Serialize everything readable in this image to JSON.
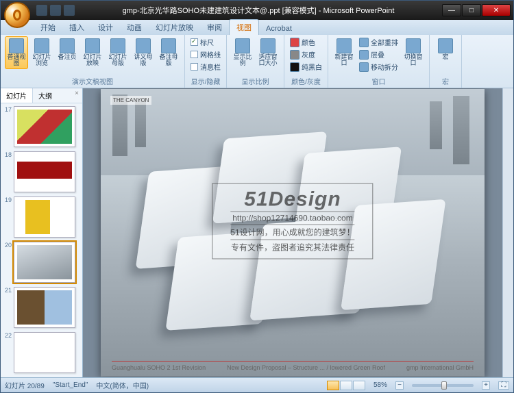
{
  "window": {
    "title": "gmp-北京光华路SOHO未建建筑设计文本@.ppt [兼容模式] - Microsoft PowerPoint",
    "min": "—",
    "max": "□",
    "close": "✕"
  },
  "tabs": [
    "开始",
    "插入",
    "设计",
    "动画",
    "幻灯片放映",
    "审阅",
    "视图",
    "Acrobat"
  ],
  "active_tab": 6,
  "ribbon": {
    "g1": {
      "label": "演示文稿视图",
      "items": [
        "普通视图",
        "幻灯片浏览",
        "备注页",
        "幻灯片放映",
        "幻灯片母版",
        "讲义母版",
        "备注母版"
      ]
    },
    "g2": {
      "label": "显示/隐藏",
      "items": [
        "标尺",
        "网格线",
        "消息栏"
      ]
    },
    "g3": {
      "label": "显示比例",
      "items": [
        "显示比例",
        "适应窗口大小"
      ]
    },
    "g4": {
      "label": "颜色/灰度",
      "items": [
        "颜色",
        "灰度",
        "纯黑白"
      ]
    },
    "g5": {
      "label": "窗口",
      "items": [
        "新建窗口",
        "全部重排",
        "层叠",
        "移动拆分",
        "切换窗口"
      ]
    },
    "g6": {
      "label": "宏",
      "items": [
        "宏"
      ]
    }
  },
  "thumbs": {
    "tabs": [
      "幻灯片",
      "大纲"
    ],
    "close": "×",
    "start_num": 17,
    "selected": 20
  },
  "slide": {
    "logo_top": "THE CANYON",
    "watermark_logo": "51Design",
    "wm_url": "http://shop12714690.taobao.com",
    "wm_l1": "51设计网，用心成就您的建筑梦！",
    "wm_l2": "专有文件，盗图者追究其法律责任",
    "footer_left": "Guanghualu SOHO 2 1st Revision",
    "footer_center": "New Design Proposal – Structure ... / lowered Green Roof",
    "footer_right": "gmp International GmbH"
  },
  "status": {
    "slide_counter": "幻灯片 20/89",
    "theme": "\"Start_End\"",
    "lang": "中文(简体，中国)",
    "zoom": "58%"
  }
}
